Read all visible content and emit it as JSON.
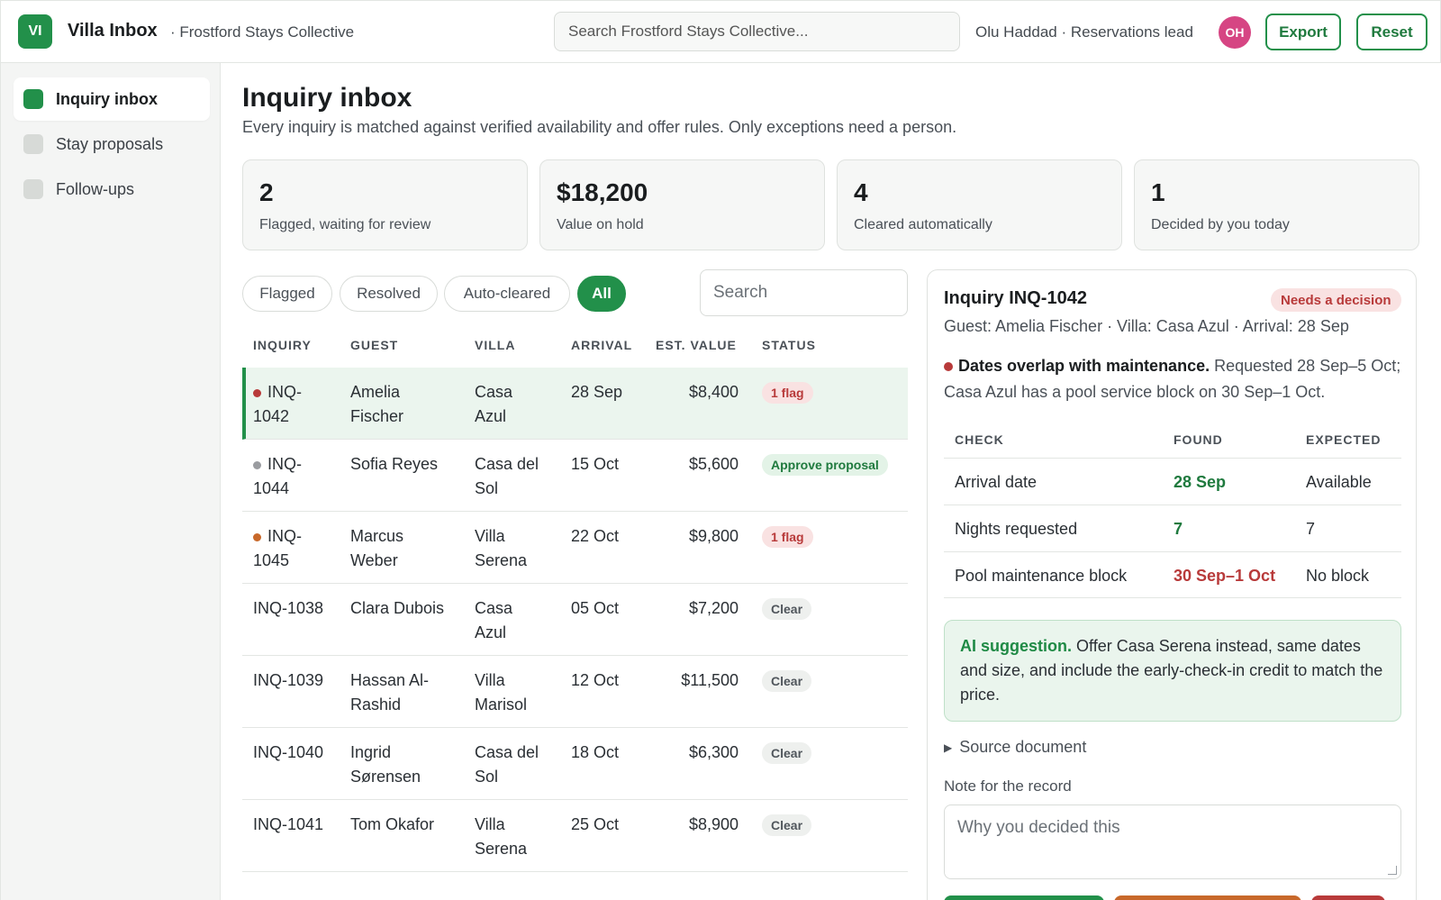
{
  "header": {
    "logo_text": "VI",
    "app_title": "Villa Inbox",
    "org_name": "· Frostford Stays Collective",
    "search_placeholder": "Search Frostford Stays Collective...",
    "user": "Olu Haddad · Reservations lead",
    "avatar_initials": "OH",
    "export_label": "Export",
    "reset_label": "Reset"
  },
  "sidebar": {
    "items": [
      {
        "label": "Inquiry inbox",
        "active": true
      },
      {
        "label": "Stay proposals",
        "active": false
      },
      {
        "label": "Follow-ups",
        "active": false
      }
    ]
  },
  "page": {
    "title": "Inquiry inbox",
    "subtitle": "Every inquiry is matched against verified availability and offer rules. Only exceptions need a person."
  },
  "stats": [
    {
      "value": "2",
      "label": "Flagged, waiting for review"
    },
    {
      "value": "$18,200",
      "label": "Value on hold"
    },
    {
      "value": "4",
      "label": "Cleared automatically"
    },
    {
      "value": "1",
      "label": "Decided by you today"
    }
  ],
  "filters": [
    {
      "label": "Flagged",
      "active": false
    },
    {
      "label": "Resolved",
      "active": false
    },
    {
      "label": "Auto-cleared",
      "active": false
    },
    {
      "label": "All",
      "active": true
    }
  ],
  "table_search_placeholder": "Search",
  "table": {
    "headers": [
      "INQUIRY",
      "GUEST",
      "VILLA",
      "ARRIVAL",
      "EST. VALUE",
      "STATUS"
    ],
    "rows": [
      {
        "id1": "INQ-",
        "id2": "1042",
        "dot": "#b83a3a",
        "guest1": "Amelia",
        "guest2": "Fischer",
        "villa1": "Casa",
        "villa2": "Azul",
        "arrival": "28 Sep",
        "value": "$8,400",
        "status": "1 flag",
        "status_type": "flag",
        "selected": true
      },
      {
        "id1": "INQ-",
        "id2": "1044",
        "dot": "#9a9ca0",
        "guest1": "Sofia Reyes",
        "guest2": "",
        "villa1": "Casa del",
        "villa2": "Sol",
        "arrival": "15 Oct",
        "value": "$5,600",
        "status": "Approve proposal",
        "status_type": "approve",
        "selected": false
      },
      {
        "id1": "INQ-",
        "id2": "1045",
        "dot": "#c8682a",
        "guest1": "Marcus",
        "guest2": "Weber",
        "villa1": "Villa",
        "villa2": "Serena",
        "arrival": "22 Oct",
        "value": "$9,800",
        "status": "1 flag",
        "status_type": "flag",
        "selected": false
      },
      {
        "id1": "INQ-1038",
        "id2": "",
        "dot": "",
        "guest1": "Clara Dubois",
        "guest2": "",
        "villa1": "Casa",
        "villa2": "Azul",
        "arrival": "05 Oct",
        "value": "$7,200",
        "status": "Clear",
        "status_type": "clear",
        "selected": false
      },
      {
        "id1": "INQ-1039",
        "id2": "",
        "dot": "",
        "guest1": "Hassan Al-",
        "guest2": "Rashid",
        "villa1": "Villa",
        "villa2": "Marisol",
        "arrival": "12 Oct",
        "value": "$11,500",
        "status": "Clear",
        "status_type": "clear",
        "selected": false
      },
      {
        "id1": "INQ-1040",
        "id2": "",
        "dot": "",
        "guest1": "Ingrid",
        "guest2": "Sørensen",
        "villa1": "Casa del",
        "villa2": "Sol",
        "arrival": "18 Oct",
        "value": "$6,300",
        "status": "Clear",
        "status_type": "clear",
        "selected": false
      },
      {
        "id1": "INQ-1041",
        "id2": "",
        "dot": "",
        "guest1": "Tom Okafor",
        "guest2": "",
        "villa1": "Villa",
        "villa2": "Serena",
        "arrival": "25 Oct",
        "value": "$8,900",
        "status": "Clear",
        "status_type": "clear",
        "selected": false
      }
    ]
  },
  "detail": {
    "title": "Inquiry INQ-1042",
    "badge": "Needs a decision",
    "meta": "Guest: Amelia Fischer · Villa: Casa Azul · Arrival: 28 Sep",
    "issue_title": "Dates overlap with maintenance.",
    "issue_body": "Requested 28 Sep–5 Oct; Casa Azul has a pool service block on 30 Sep–1 Oct.",
    "check_headers": [
      "CHECK",
      "FOUND",
      "EXPECTED"
    ],
    "checks": [
      {
        "check": "Arrival date",
        "found": "28 Sep",
        "expected": "Available",
        "ok": true
      },
      {
        "check": "Nights requested",
        "found": "7",
        "expected": "7",
        "ok": true
      },
      {
        "check": "Pool maintenance block",
        "found": "30 Sep–1 Oct",
        "expected": "No block",
        "ok": false
      }
    ],
    "ai_lead": "AI suggestion.",
    "ai_text": "Offer Casa Serena instead, same dates and size, and include the early-check-in credit to match the price.",
    "source_doc": "Source document",
    "note_label": "Note for the record",
    "note_placeholder": "Why you decided this"
  },
  "colors": {
    "accent": "#22904a",
    "danger": "#b83a3a",
    "warning": "#c8682a"
  }
}
